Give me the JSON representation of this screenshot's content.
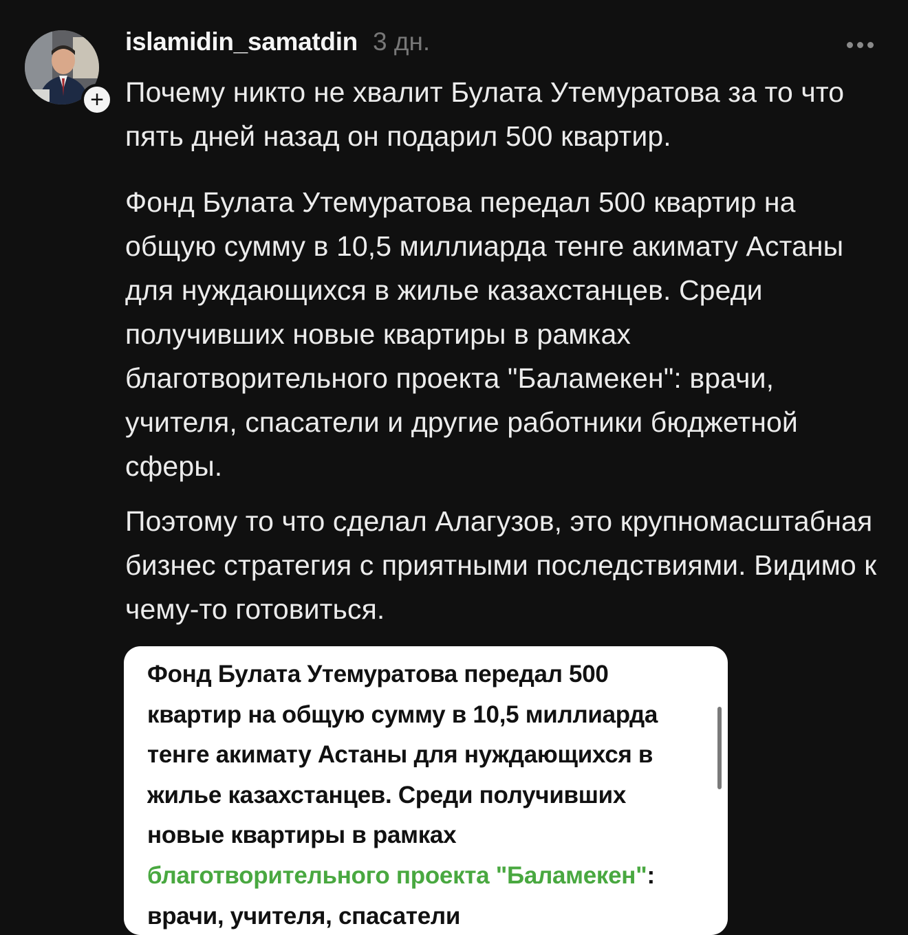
{
  "post": {
    "username": "islamidin_samatdin",
    "time": "3 дн.",
    "more_icon": "more-horizontal-icon",
    "follow_icon": "plus-icon",
    "paragraphs": [
      "Почему никто не хвалит Булата Утемуратова за то что пять дней назад он подарил 500 квартир.",
      "Фонд Булата Утемуратова передал 500 квартир на общую сумму в 10,5 миллиарда тенге акимату Астаны для нуждающихся в жилье казахстанцев. Среди получивших новые квартиры в рамках благотворительного проекта \"Баламекен\": врачи, учителя, спасатели и другие работники бюджетной сферы.",
      "Поэтому то что сделал Алагузов, это крупномасштабная бизнес стратегия с приятными последствиями. Видимо к чему-то готовиться."
    ]
  },
  "card": {
    "text_before_link": "Фонд Булата Утемуратова передал 500 квартир на общую сумму в 10,5 миллиарда тенге акимату Астаны для нуждающихся в жилье казахстанцев. Среди получивших новые квартиры в рамках ",
    "link_text": "благотворительного проекта \"Баламекен\"",
    "text_after_link": ": врачи, учителя, спасатели",
    "link_color": "#49a840"
  },
  "colors": {
    "background": "#101010",
    "text": "#ececec",
    "muted": "#777777"
  }
}
